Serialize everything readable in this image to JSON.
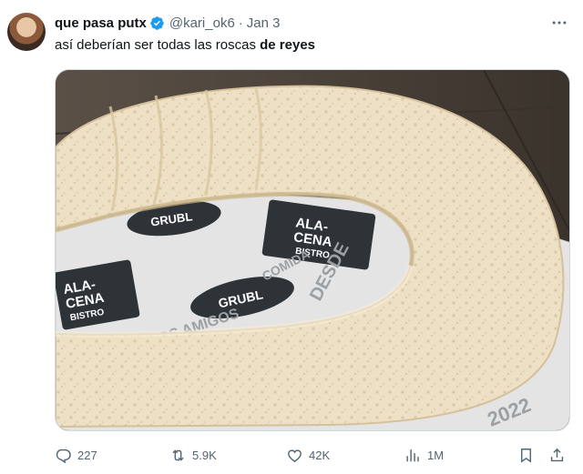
{
  "tweet": {
    "display_name": "que pasa putx",
    "handle": "@kari_ok6",
    "separator": "·",
    "date": "Jan 3",
    "text_normal": "así deberían ser todas las roscas ",
    "text_bold": "de reyes"
  },
  "media": {
    "wrapper_text": [
      "ALA-",
      "CENA",
      "BISTRO",
      "GRUBL",
      "PARA LOS AMIGOS",
      "COMIDA",
      "DESDE",
      "2022"
    ]
  },
  "actions": {
    "replies": "227",
    "retweets": "5.9K",
    "likes": "42K",
    "views": "1M"
  },
  "colors": {
    "text_primary": "#0f1419",
    "text_secondary": "#536471",
    "verified_blue": "#1d9bf0",
    "border": "#cfd9de"
  },
  "icons": [
    "more-icon",
    "verified-icon",
    "reply-icon",
    "retweet-icon",
    "like-icon",
    "views-icon",
    "bookmark-icon",
    "share-icon"
  ]
}
